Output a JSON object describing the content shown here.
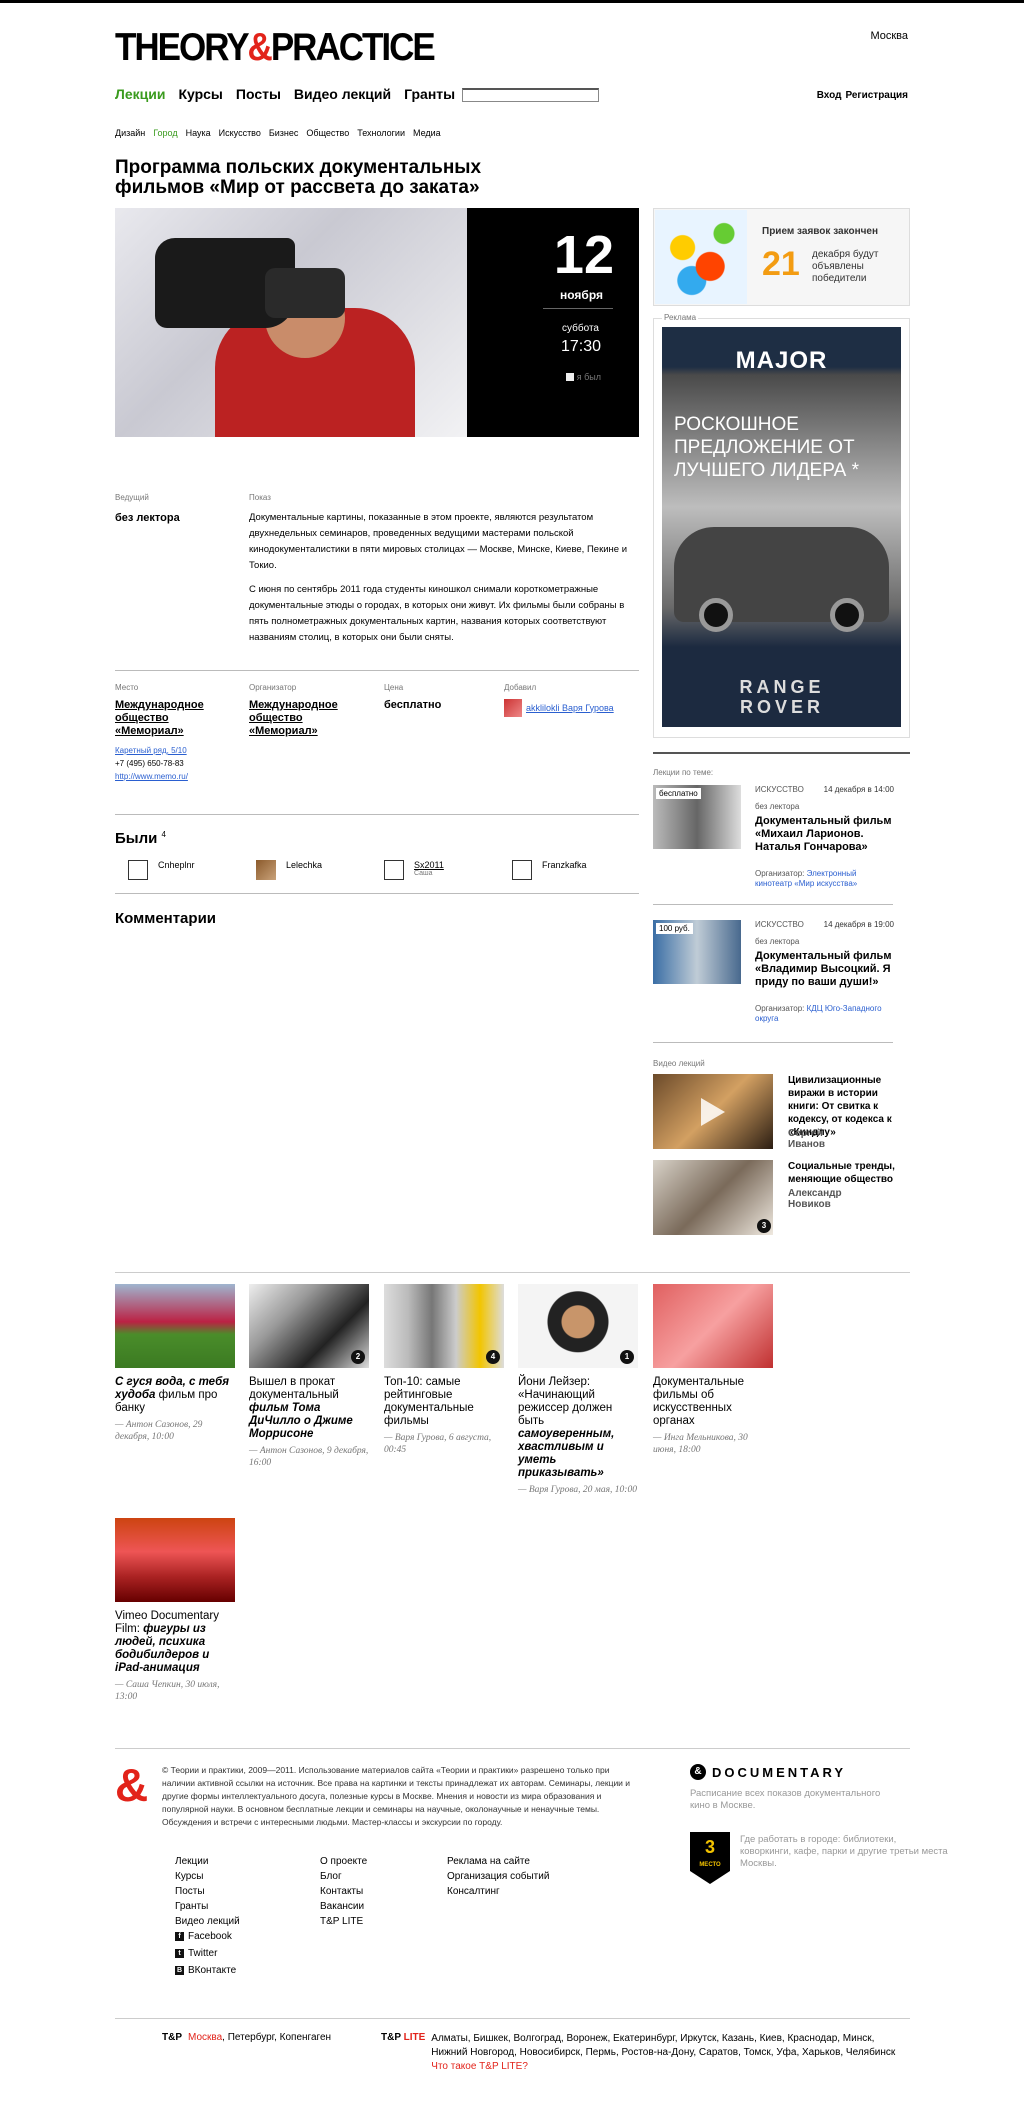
{
  "header": {
    "logo_a": "THEORY",
    "logo_amp": "&",
    "logo_b": "PRACTICE",
    "city": "Москва",
    "nav": [
      "Лекции",
      "Курсы",
      "Посты",
      "Видео лекций",
      "Гранты"
    ],
    "login": "Вход",
    "register": "Регистрация",
    "search_value": ""
  },
  "subnav": [
    "Дизайн",
    "Город",
    "Наука",
    "Искусство",
    "Бизнес",
    "Общество",
    "Технологии",
    "Медиа"
  ],
  "event": {
    "title": "Программа польских документальных фильмов «Мир от рассвета до заката»",
    "day": "12",
    "month": "ноября",
    "weekday": "суббота",
    "time": "17:30",
    "was_label": "я был",
    "lecturer_label": "Ведущий",
    "lecturer": "без лектора",
    "show_label": "Показ",
    "desc1": "Документальные картины, показанные в этом проекте, являются результатом двухнедельных семинаров, проведенных ведущими мастерами польской кинодокументалистики в пяти мировых столицах — Москве, Минске, Киеве, Пекине и Токио.",
    "desc2": "С июня по сентябрь 2011 года студенты киношкол снимали короткометражные документальные этюды о городах, в которых они живут. Их фильмы были собраны в пять полнометражных документальных картин, названия которых соответствуют названиям столиц, в которых они были сняты.",
    "place_label": "Место",
    "place": "Международное общество «Мемориал»",
    "address": "Каретный ряд, 5/10",
    "phone": "+7 (495) 650-78-83",
    "site": "http://www.memo.ru/",
    "org_label": "Организатор",
    "org": "Международное общество «Мемориал»",
    "price_label": "Цена",
    "price": "бесплатно",
    "added_label": "Добавил",
    "added_by": "akklilokli Варя Гурова"
  },
  "were": {
    "title": "Были",
    "count": "4",
    "people": [
      {
        "name": "Cnheplnr",
        "sub": ""
      },
      {
        "name": "Lelechka",
        "sub": ""
      },
      {
        "name": "Sx2011",
        "sub": "Саша"
      },
      {
        "name": "Franzkafka",
        "sub": ""
      }
    ]
  },
  "comments_title": "Комментарии",
  "sidebar": {
    "promo_t1": "Прием заявок закончен",
    "promo_num": "21",
    "promo_t2": "декабря будут объявлены победители",
    "ad_label": "Реклама",
    "ad_brand": "MAJOR",
    "ad_slogan": "РОСКОШНОЕ ПРЕДЛОЖЕНИЕ ОТ ЛУЧШЕГО ЛИДЕРА *",
    "ad_car": "RANGE ROVER",
    "related_label": "Лекции по теме:",
    "related": [
      {
        "tag": "бесплатно",
        "cat": "ИСКУССТВО",
        "date": "14 декабря в 14:00",
        "who": "без лектора",
        "title": "Документальный фильм «Михаил Ларионов. Наталья Гончарова»",
        "org_label": "Организатор:",
        "org": "Электронный кинотеатр «Мир искусства»"
      },
      {
        "tag": "100 руб.",
        "cat": "ИСКУССТВО",
        "date": "14 декабря в 19:00",
        "who": "без лектора",
        "title": "Документальный фильм «Владимир Высоцкий. Я приду по ваши души!»",
        "org_label": "Организатор:",
        "org": "КДЦ Юго-Западного округа"
      }
    ],
    "video_label": "Видео лекций",
    "videos": [
      {
        "title": "Цивилизационные виражи в истории книги: От свитка к кодексу, от кодекса к «Киндлу»",
        "author": "Сергей Иванов",
        "num": ""
      },
      {
        "title": "Социальные тренды, меняющие общество",
        "author": "Александр Новиков",
        "num": "3"
      }
    ]
  },
  "cards": [
    {
      "t1": "С гуся вода, с тебя худоба",
      "t2": " фильм про банку",
      "by": "— Антон Сазонов, 29 декабря, 10:00",
      "badge": ""
    },
    {
      "t1": "Вышел в прокат документальный ",
      "t2": "фильм Тома ДиЧилло о Джиме Моррисоне",
      "by": "— Антон Сазонов, 9 декабря, 16:00",
      "badge": "2"
    },
    {
      "t1": "Топ-10: самые рейтинговые документальные фильмы",
      "t2": "",
      "by": "— Варя Гурова, 6 августа, 00:45",
      "badge": "4"
    },
    {
      "t1": "Йони Лейзер: «Начинающий режиссер должен быть ",
      "t2": "самоуверенным, хвастливым и уметь приказывать»",
      "by": "— Варя Гурова, 20 мая, 10:00",
      "badge": "1"
    },
    {
      "t1": "Документальные фильмы об искусственных органах",
      "t2": "",
      "by": "— Инга Мельникова, 30 июня, 18:00",
      "badge": ""
    },
    {
      "t1": "Vimeo Documentary Film: ",
      "t2": "фигуры из людей, психика бодибилдеров и iPad-анимация",
      "by": "— Саша Чепкин, 30 июля, 13:00",
      "badge": ""
    }
  ],
  "footer": {
    "copy": "© Теории и практики, 2009—2011. Использование материалов сайта «Теории и практики» разрешено только при наличии активной ссылки на источник. Все права на картинки и тексты принадлежат их авторам. Семинары, лекции и другие формы интеллектуального досуга, полезные курсы в Москве. Мнения и новости из мира образования и популярной науки. В основном бесплатные лекции и семинары на научные, околонаучные и ненаучные темы. Обсуждения и встречи с интересными людьми. Мастер-классы и экскурсии по городу.",
    "col1": [
      "Лекции",
      "Курсы",
      "Посты",
      "Гранты",
      "Видео лекций"
    ],
    "social": [
      "Facebook",
      "Twitter",
      "ВКонтакте"
    ],
    "col2": [
      "О проекте",
      "Блог",
      "Контакты",
      "Вакансии",
      "T&P LITE"
    ],
    "col3": [
      "Реклама на сайте",
      "Организация событий",
      "Консалтинг"
    ],
    "doc_title": "DOCUMENTARY",
    "doc_desc": "Расписание всех показов документального кино в Москве.",
    "place_num": "3",
    "place_word": "МЕСТО",
    "place_desc": "Где работать в городе: библиотеки, коворкинги, кафе, парки и другие третьи места Москвы.",
    "tp": "T&P",
    "tp_cities_red": "Москва",
    "tp_cities": ", Петербург, Копенгаген",
    "lite_a": "T&P ",
    "lite_b": "LITE",
    "lite_cities": "Алматы, Бишкек, Волгоград, Воронеж, Екатеринбург, Иркутск, Казань, Киев, Краснодар, Минск, Нижний Новгород, Новосибирск, Пермь, Ростов-на-Дону, Саратов, Томск, Уфа, Харьков, Челябинск",
    "lite_q": "Что такое T&P LITE?"
  },
  "colors": {
    "accent_green": "#3a9b1e",
    "accent_red": "#e2231a",
    "promo_orange": "#f39c12",
    "link_blue": "#2a5fd0"
  }
}
